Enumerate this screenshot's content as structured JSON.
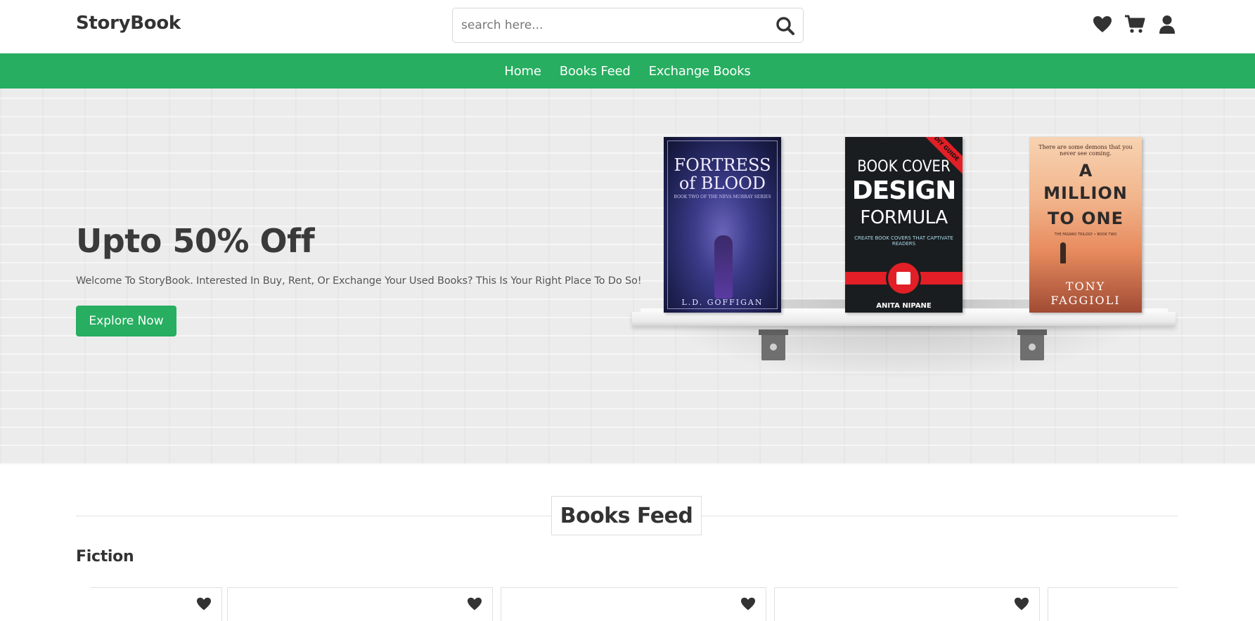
{
  "header": {
    "logo": "StoryBook",
    "search": {
      "placeholder": "search here..."
    },
    "icons": [
      "heart-icon",
      "cart-icon",
      "user-icon"
    ]
  },
  "nav": {
    "items": [
      {
        "label": "Home"
      },
      {
        "label": "Books Feed"
      },
      {
        "label": "Exchange Books"
      }
    ]
  },
  "hero": {
    "title": "Upto 50% Off",
    "text": "Welcome To StoryBook. Interested In Buy, Rent, Or Exchange Your Used Books? This Is Your Right Place To Do So!",
    "button": "Explore Now",
    "books": [
      {
        "title_line1": "FORTRESS",
        "title_line2": "of BLOOD",
        "subtitle": "BOOK TWO OF THE NEVA MURRAY SERIES",
        "author": "L.D. GOFFIGAN"
      },
      {
        "ribbon": "DIY GUIDE",
        "title_line1": "BOOK COVER",
        "title_line2": "DESIGN",
        "title_line3": "FORMULA",
        "subtitle": "CREATE BOOK COVERS THAT CAPTIVATE READERS",
        "author": "ANITA NIPANE"
      },
      {
        "tagline": "There are some demons that you never see coming.",
        "title_line1": "A",
        "title_line2": "MILLION",
        "title_line3": "TO ONE",
        "subtitle": "THE FASANO TRILOGY • BOOK TWO",
        "author_line1": "TONY",
        "author_line2": "FAGGIOLI"
      }
    ]
  },
  "feed": {
    "heading": "Books Feed",
    "category": "Fiction",
    "card_count": 5
  },
  "colors": {
    "accent": "#27ae60",
    "text": "#333333"
  }
}
